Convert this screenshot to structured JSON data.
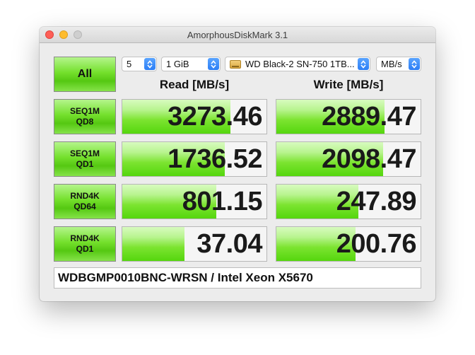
{
  "window": {
    "title": "AmorphousDiskMark 3.1"
  },
  "controls": {
    "all_label": "All",
    "count": "5",
    "size": "1 GiB",
    "drive": "WD Black-2 SN-750 1TB...",
    "unit": "MB/s"
  },
  "headers": {
    "read": "Read [MB/s]",
    "write": "Write [MB/s]"
  },
  "tests": [
    {
      "line1": "SEQ1M",
      "line2": "QD8",
      "read": "3273.46",
      "write": "2889.47",
      "read_fill": 0.75,
      "write_fill": 0.75
    },
    {
      "line1": "SEQ1M",
      "line2": "QD1",
      "read": "1736.52",
      "write": "2098.47",
      "read_fill": 0.71,
      "write_fill": 0.74
    },
    {
      "line1": "RND4K",
      "line2": "QD64",
      "read": "801.15",
      "write": "247.89",
      "read_fill": 0.65,
      "write_fill": 0.57
    },
    {
      "line1": "RND4K",
      "line2": "QD1",
      "read": "37.04",
      "write": "200.76",
      "read_fill": 0.43,
      "write_fill": 0.55
    }
  ],
  "footer": {
    "text": "WDBGMP0010BNC-WRSN / Intel Xeon X5670"
  },
  "colors": {
    "green_accent": "#6cde24",
    "select_chevron": "#2c7ef5"
  }
}
